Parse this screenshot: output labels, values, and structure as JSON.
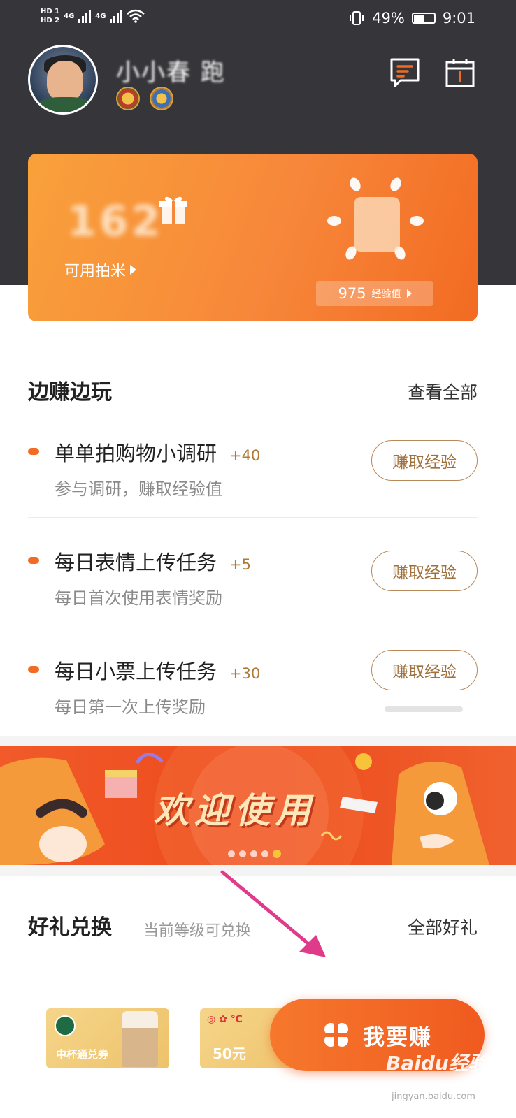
{
  "status_bar": {
    "hd_top": "HD 1",
    "hd_bottom": "HD 2",
    "net1": "4G",
    "net2": "4G",
    "battery": "49%",
    "time": "9:01"
  },
  "profile": {
    "username": "小小春 跑",
    "icons": [
      "message-icon",
      "calendar-icon"
    ]
  },
  "points_card": {
    "points": "162",
    "points_label": "可用拍米",
    "exp_value": "975",
    "exp_unit": "经验值"
  },
  "earn_play": {
    "title": "边赚边玩",
    "view_all": "查看全部",
    "tasks": [
      {
        "title": "单单拍购物小调研",
        "points": "+40",
        "desc": "参与调研，赚取经验值",
        "button": "赚取经验"
      },
      {
        "title": "每日表情上传任务",
        "points": "+5",
        "desc": "每日首次使用表情奖励",
        "button": "赚取经验"
      },
      {
        "title": "每日小票上传任务",
        "points": "+30",
        "desc": "每日第一次上传奖励",
        "button": "赚取经验"
      }
    ]
  },
  "banner": {
    "text": "欢迎使用",
    "slides": 5,
    "active_slide": 5
  },
  "gifts": {
    "title": "好礼兑换",
    "subtitle": "当前等级可兑换",
    "all_gifts": "全部好礼",
    "cards": [
      {
        "label": "中杯通兑券"
      },
      {
        "label": "50元"
      }
    ]
  },
  "earn_button": {
    "label": "我要赚"
  },
  "watermark": {
    "text": "Baidu经验",
    "sub": "jingyan.baidu.com"
  },
  "colors": {
    "header_bg": "#35353a",
    "accent": "#f26b22",
    "button_border": "#b88a5a"
  }
}
